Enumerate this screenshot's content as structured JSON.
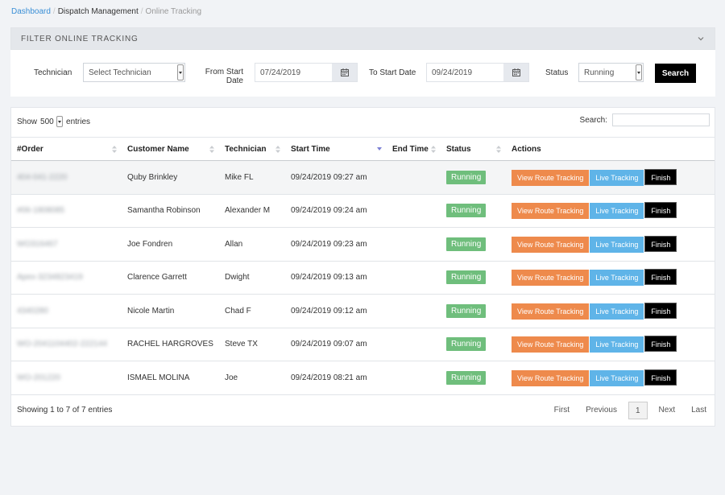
{
  "breadcrumb": {
    "home": "Dashboard",
    "section": "Dispatch Management",
    "current": "Online Tracking",
    "separator": "/"
  },
  "filter": {
    "title": "FILTER ONLINE TRACKING",
    "technician_label": "Technician",
    "technician_value": "Select Technician",
    "from_label_1": "From Start",
    "from_label_2": "Date",
    "from_value": "07/24/2019",
    "to_label": "To Start Date",
    "to_value": "09/24/2019",
    "status_label": "Status",
    "status_value": "Running",
    "search_button": "Search"
  },
  "table": {
    "show_label": "Show",
    "entries_value": "500",
    "entries_label": "entries",
    "search_label": "Search:",
    "columns": [
      "#Order",
      "Customer Name",
      "Technician",
      "Start Time",
      "End Time",
      "Status",
      "Actions"
    ],
    "rows": [
      {
        "order": "404-041-2220",
        "customer": "Quby Brinkley",
        "technician": "Mike FL",
        "start": "09/24/2019 09:27 am",
        "end": "",
        "status": "Running"
      },
      {
        "order": "#06-1808085",
        "customer": "Samantha Robinson",
        "technician": "Alexander M",
        "start": "09/24/2019 09:24 am",
        "end": "",
        "status": "Running"
      },
      {
        "order": "WO316467",
        "customer": "Joe Fondren",
        "technician": "Allan",
        "start": "09/24/2019 09:23 am",
        "end": "",
        "status": "Running"
      },
      {
        "order": "Apex-3234823419",
        "customer": "Clarence Garrett",
        "technician": "Dwight",
        "start": "09/24/2019 09:13 am",
        "end": "",
        "status": "Running"
      },
      {
        "order": "4340280",
        "customer": "Nicole Martin",
        "technician": "Chad F",
        "start": "09/24/2019 09:12 am",
        "end": "",
        "status": "Running"
      },
      {
        "order": "WO-2041104402-222144",
        "customer": "RACHEL HARGROVES",
        "technician": "Steve TX",
        "start": "09/24/2019 09:07 am",
        "end": "",
        "status": "Running"
      },
      {
        "order": "WO-201220",
        "customer": "ISMAEL MOLINA",
        "technician": "Joe",
        "start": "09/24/2019 08:21 am",
        "end": "",
        "status": "Running"
      }
    ],
    "actions": {
      "route": "View Route Tracking",
      "live": "Live Tracking",
      "finish": "Finish"
    },
    "info": "Showing 1 to 7 of 7 entries",
    "pager": {
      "first": "First",
      "previous": "Previous",
      "page": "1",
      "next": "Next",
      "last": "Last"
    }
  },
  "colors": {
    "running": "#6fbe7c",
    "route_button": "#ee8a4c",
    "live_button": "#5fb4e8",
    "finish_button": "#000000",
    "link": "#3a8fd6"
  }
}
